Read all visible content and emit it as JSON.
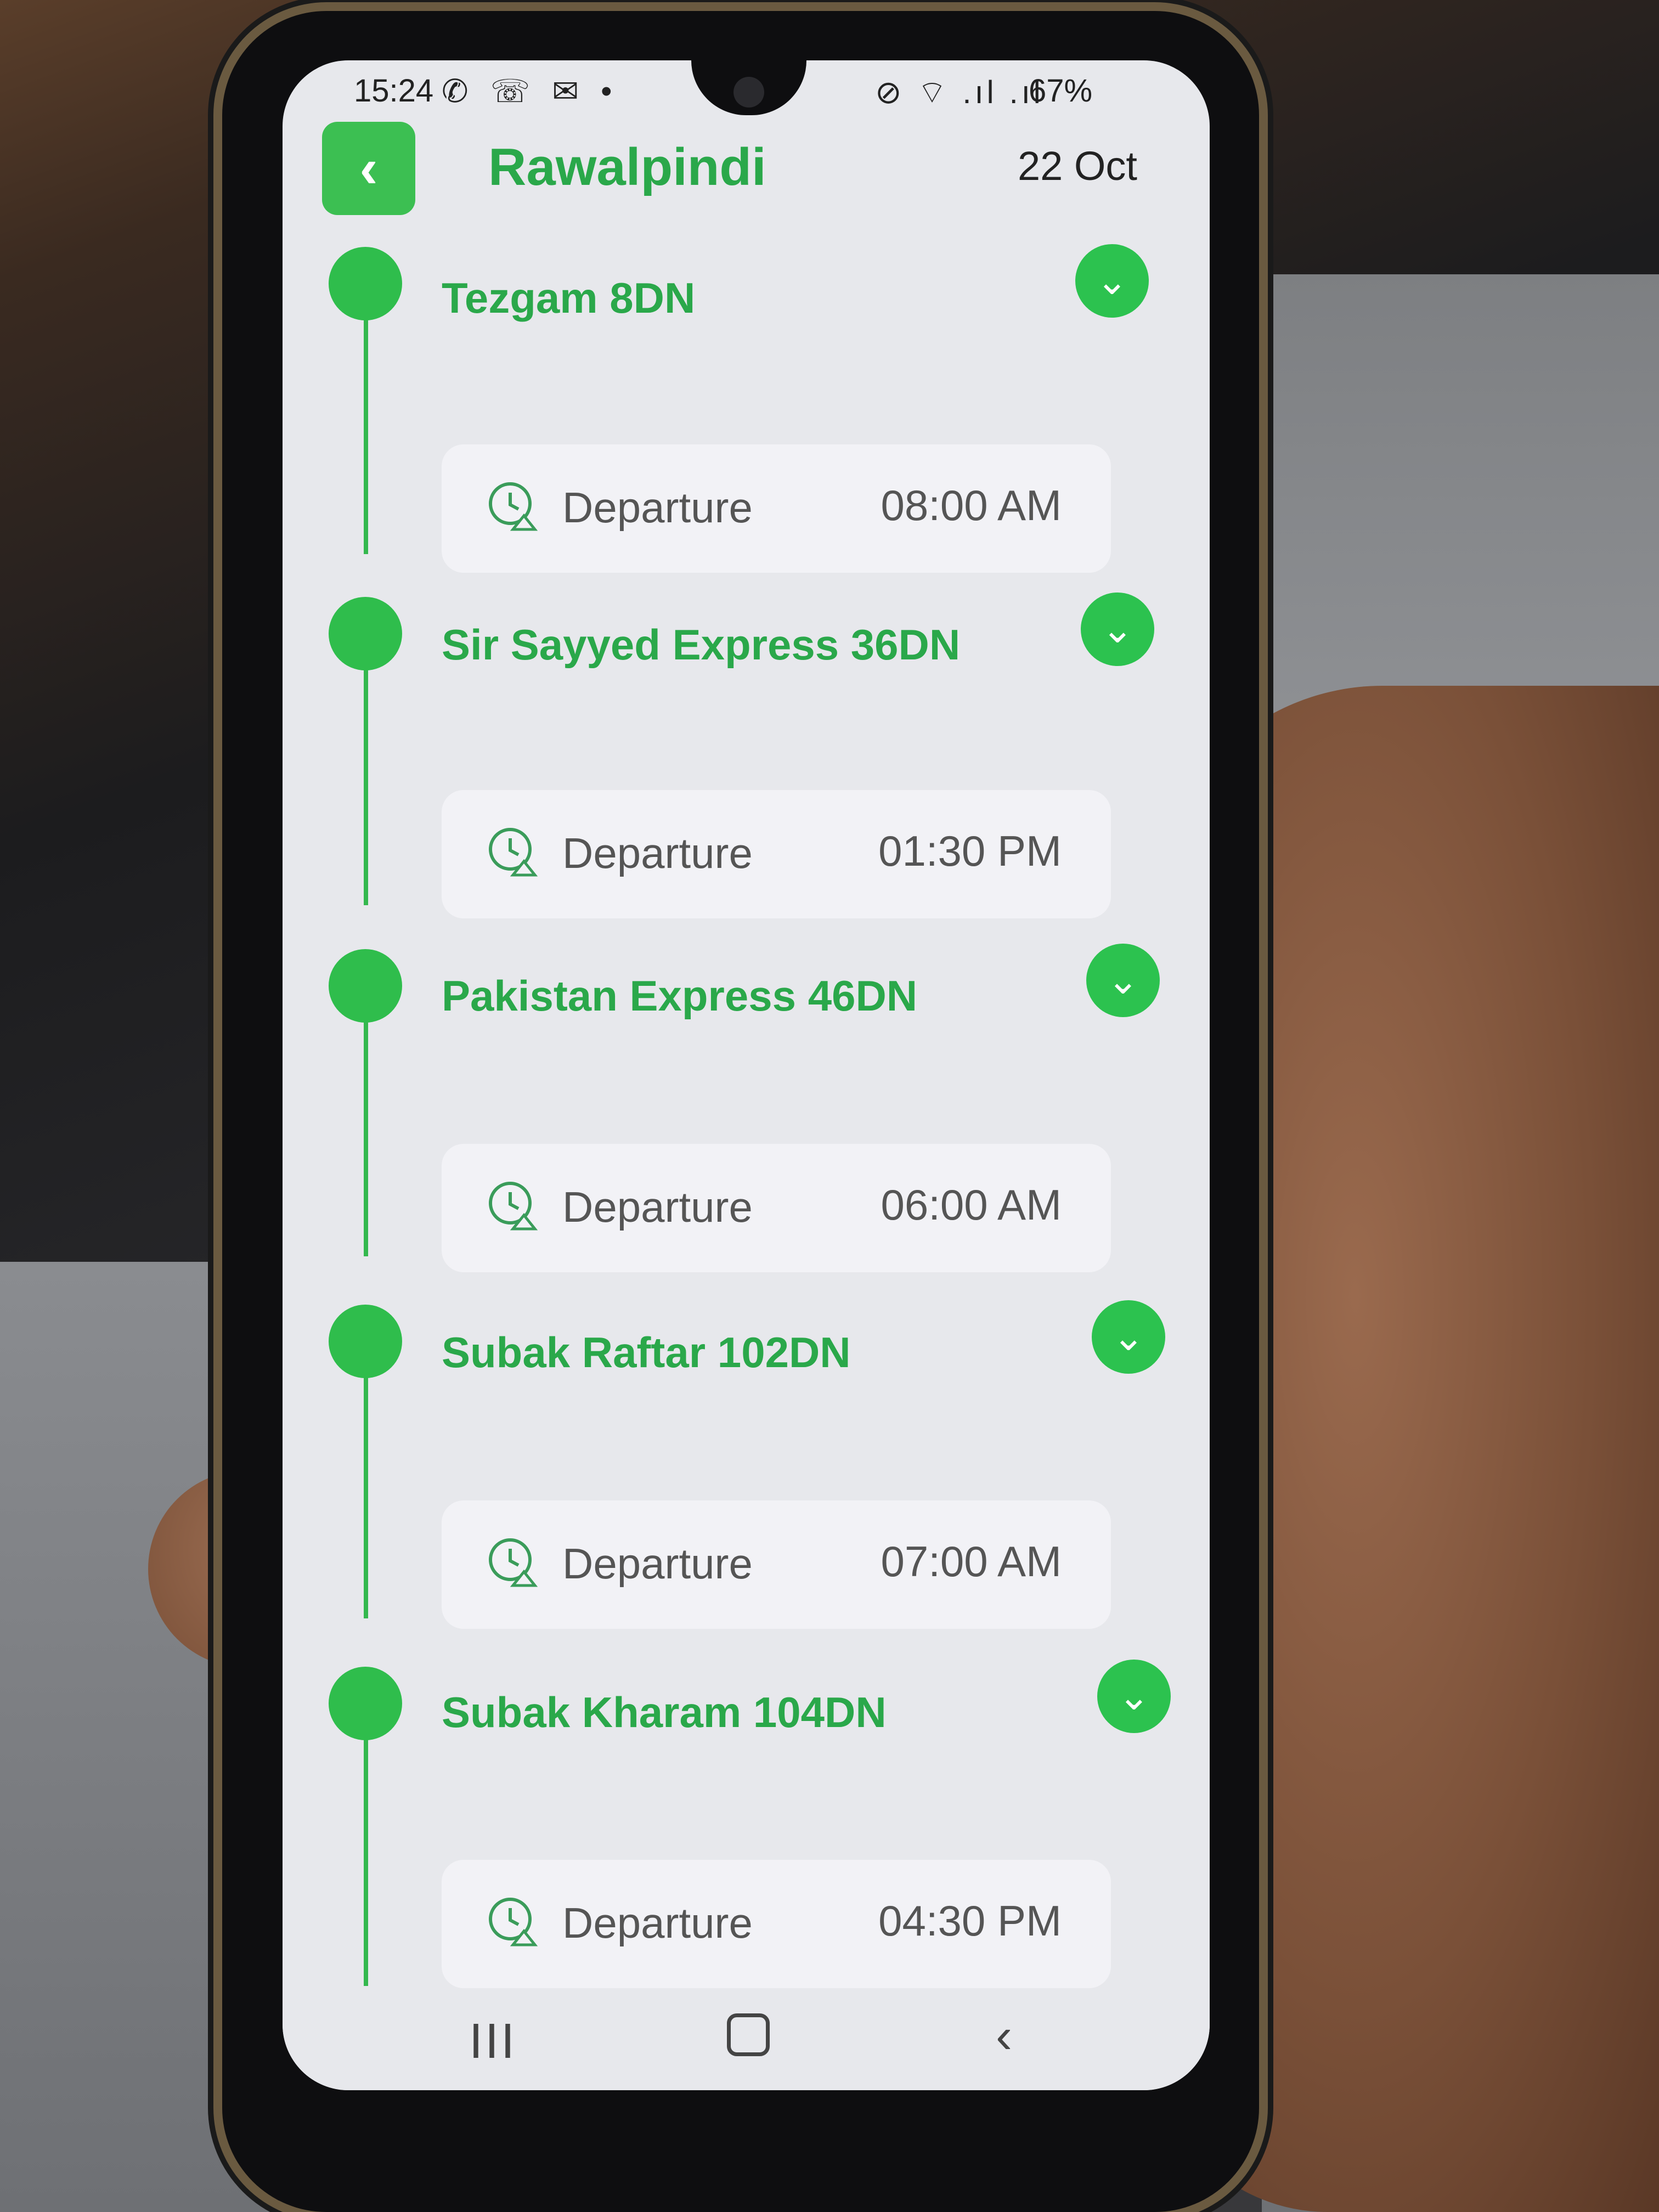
{
  "status_bar": {
    "time": "15:24",
    "left_icons": "✆ ☏ ✉ •",
    "right_icons": "⊘ ⌔ .ıl .ıl",
    "battery": "67%"
  },
  "header": {
    "back_icon": "‹",
    "title": "Rawalpindi",
    "date": "22 Oct"
  },
  "trains": [
    {
      "name": "Tezgam 8DN",
      "departure_label": "Departure",
      "departure_time": "08:00 AM"
    },
    {
      "name": "Sir Sayyed Express 36DN",
      "departure_label": "Departure",
      "departure_time": "01:30 PM"
    },
    {
      "name": "Pakistan Express 46DN",
      "departure_label": "Departure",
      "departure_time": "06:00 AM"
    },
    {
      "name": "Subak Raftar 102DN",
      "departure_label": "Departure",
      "departure_time": "07:00 AM"
    },
    {
      "name": "Subak Kharam 104DN",
      "departure_label": "Departure",
      "departure_time": "04:30 PM"
    }
  ],
  "toggle_icon": "⌄",
  "nav": {
    "recent": "III",
    "back": "‹"
  },
  "colors": {
    "accent": "#2fbd4c",
    "title": "#2aa84a",
    "card": "#f2f2f6",
    "screen": "#e7e8ec"
  }
}
